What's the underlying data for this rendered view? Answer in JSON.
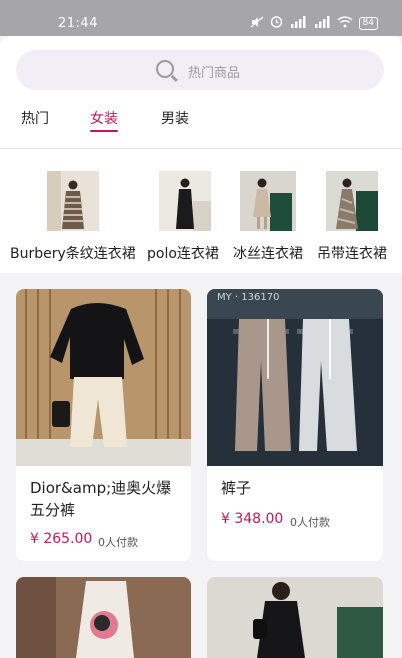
{
  "status": {
    "time": "21:44",
    "battery": "84"
  },
  "search": {
    "placeholder": "热门商品"
  },
  "tabs": [
    {
      "label": "热门",
      "active": false
    },
    {
      "label": "女装",
      "active": true
    },
    {
      "label": "男装",
      "active": false
    }
  ],
  "categories": [
    {
      "label": "Burbery条纹连衣裙"
    },
    {
      "label": "polo连衣裙"
    },
    {
      "label": "冰丝连衣裙"
    },
    {
      "label": "吊带连衣裙"
    }
  ],
  "products": [
    {
      "title": "Dior&amp;迪奥火爆五分裤",
      "price": "¥ 265.00",
      "paid": "0人付款"
    },
    {
      "title": "裤子",
      "price": "¥ 348.00",
      "paid": "0人付款"
    },
    {
      "title": "",
      "price": "",
      "paid": ""
    },
    {
      "title": "",
      "price": "",
      "paid": ""
    }
  ],
  "image_text": {
    "tag": "MY · 136170"
  },
  "colors": {
    "accent": "#c2185b",
    "background": "#f3f3f6",
    "status_bar": "#a6a6a9"
  }
}
